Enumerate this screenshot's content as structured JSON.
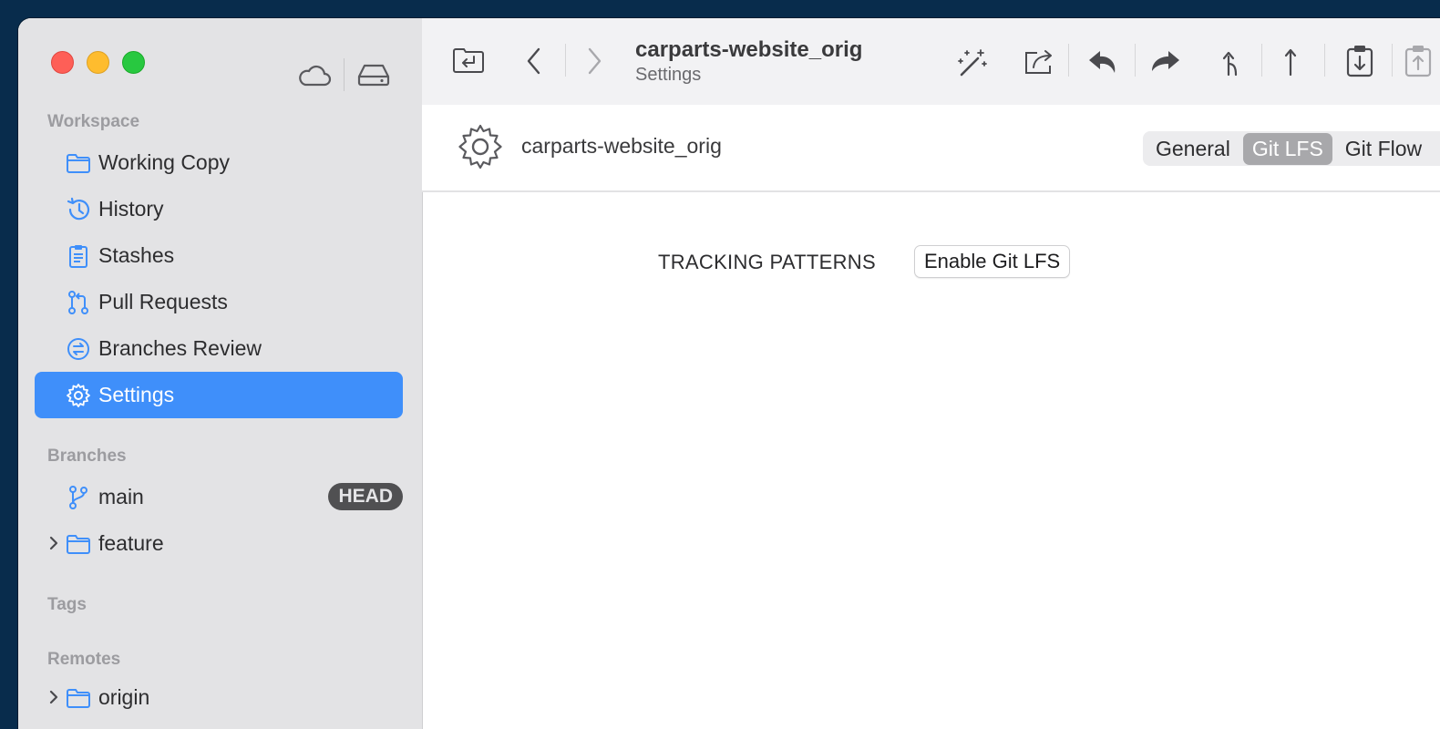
{
  "toolbar": {
    "repo_title": "carparts-website_orig",
    "subtitle": "Settings"
  },
  "sidebar": {
    "workspace_header": "Workspace",
    "workspace_items": [
      {
        "label": "Working Copy",
        "icon": "folder-icon"
      },
      {
        "label": "History",
        "icon": "history-icon"
      },
      {
        "label": "Stashes",
        "icon": "clipboard-icon"
      },
      {
        "label": "Pull Requests",
        "icon": "pull-request-icon"
      },
      {
        "label": "Branches Review",
        "icon": "branches-review-icon"
      },
      {
        "label": "Settings",
        "icon": "gear-icon",
        "active": true
      }
    ],
    "branches_header": "Branches",
    "branches": [
      {
        "label": "main",
        "badge": "HEAD",
        "icon": "branch-icon"
      },
      {
        "label": "feature",
        "icon": "folder-icon",
        "collapsed": true
      }
    ],
    "tags_header": "Tags",
    "remotes_header": "Remotes",
    "remotes": [
      {
        "label": "origin",
        "icon": "folder-icon",
        "collapsed": true
      }
    ]
  },
  "content": {
    "repo_name": "carparts-website_orig",
    "tabs": [
      "General",
      "Git LFS",
      "Git Flow"
    ],
    "active_tab": "Git LFS",
    "tracking_label": "TRACKING PATTERNS",
    "enable_button": "Enable Git LFS"
  },
  "colors": {
    "accent": "#3f8ffa",
    "sidebar_bg": "#e3e3e5",
    "desktop_bg": "#082c4c"
  }
}
